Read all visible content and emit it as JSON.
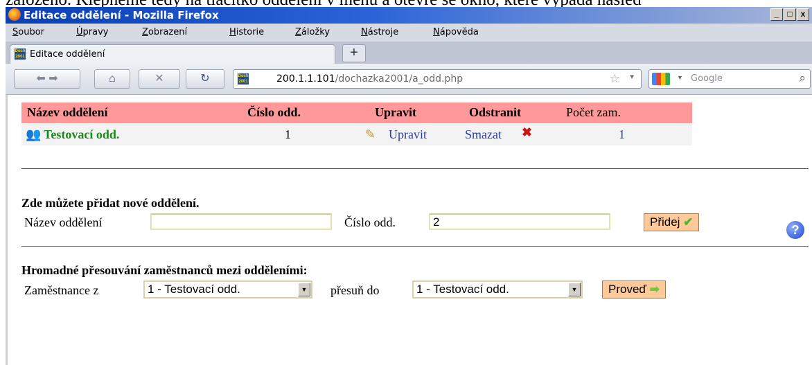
{
  "caption": "založeno. Klepneme tedy na tlačítko oddělení v menu a otevře se okno, které vypadá násled",
  "window": {
    "title": "Editace oddělení - Mozilla Firefox",
    "buttons": [
      "_",
      "□",
      "x"
    ]
  },
  "menu": [
    "Soubor",
    "Úpravy",
    "Zobrazení",
    "Historie",
    "Záložky",
    "Nástroje",
    "Nápověda"
  ],
  "tab": {
    "label": "Editace oddělení",
    "new_tab": "+"
  },
  "nav": {
    "url_host": "200.1.1.101",
    "url_path": "/dochazka2001/a_odd.php",
    "search_placeholder": "Google"
  },
  "table": {
    "headers": [
      "Název oddělení",
      "Číslo odd.",
      "Upravit",
      "Odstranit",
      "Počet zam."
    ],
    "row": {
      "name": "Testovací odd.",
      "number": "1",
      "edit": "Upravit",
      "delete": "Smazat",
      "count": "1"
    }
  },
  "add_section": {
    "title": "Zde můžete přidat nové oddělení.",
    "name_label": "Název oddělení",
    "name_value": "",
    "number_label": "Číslo odd.",
    "number_value": "2",
    "button": "Přidej"
  },
  "move_section": {
    "title": "Hromadné přesouvání zaměstnanců mezi odděleními:",
    "from_label": "Zaměstnance z",
    "from_value": "1 - Testovací odd.",
    "to_label": "přesuň do",
    "to_value": "1 - Testovací odd.",
    "button": "Proveď"
  },
  "colors": {
    "header_bg": "#ff9999",
    "button_bg": "#ffc999",
    "dept_name": "#1a8a1a",
    "link": "#2b3fa8"
  }
}
